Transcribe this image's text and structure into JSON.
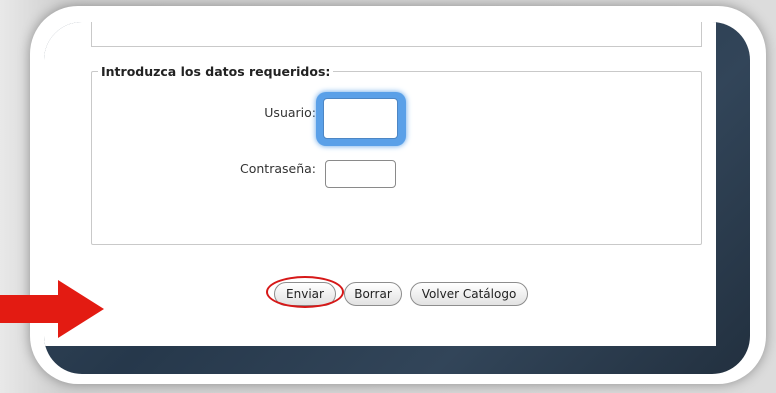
{
  "form": {
    "legend": "Introduzca los datos requeridos:",
    "username_label": "Usuario:",
    "password_label": "Contraseña:",
    "username_value": "",
    "password_value": ""
  },
  "buttons": {
    "submit": "Enviar",
    "clear": "Borrar",
    "back": "Volver Catálogo"
  },
  "annotation": {
    "arrow_color": "#e31b12",
    "highlight_color": "#d61818"
  }
}
